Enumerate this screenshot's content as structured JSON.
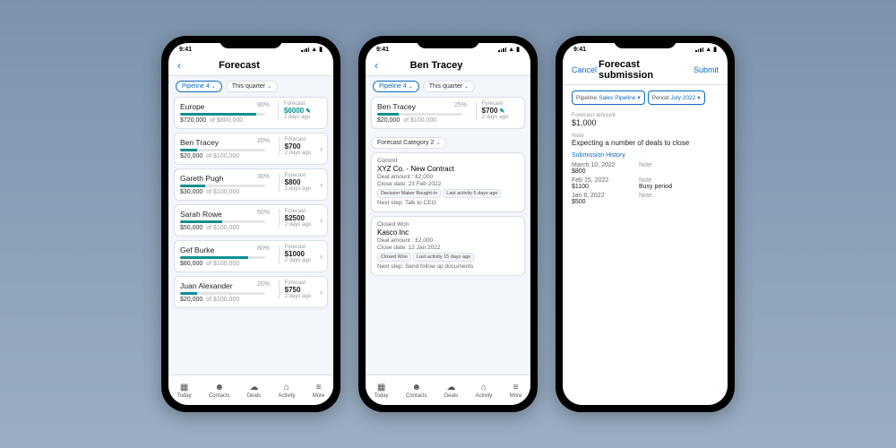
{
  "status": {
    "time": "9:41"
  },
  "tabs": {
    "today": "Today",
    "contacts": "Contacts",
    "deals": "Deals",
    "activity": "Activity",
    "more": "More"
  },
  "p1": {
    "title": "Forecast",
    "filters": {
      "pipeline": "Pipeline 4",
      "period": "This quarter"
    },
    "rows": [
      {
        "name": "Europe",
        "pct": "90%",
        "bar": 90,
        "amount": "$720,000",
        "of": "of $800,000",
        "flabel": "Forecast",
        "fval": "$6000",
        "fago": "2 days ago",
        "teal": true,
        "go": false,
        "pencil": true
      },
      {
        "name": "Ben Tracey",
        "pct": "20%",
        "bar": 20,
        "amount": "$20,000",
        "of": "of $100,000",
        "flabel": "Forecast",
        "fval": "$700",
        "fago": "2 days ago",
        "teal": false,
        "go": true
      },
      {
        "name": "Gareth Pugh",
        "pct": "30%",
        "bar": 30,
        "amount": "$30,000",
        "of": "of $100,000",
        "flabel": "Forecast",
        "fval": "$800",
        "fago": "2 days ago",
        "teal": false,
        "go": true
      },
      {
        "name": "Sarah Rowe",
        "pct": "50%",
        "bar": 50,
        "amount": "$50,000",
        "of": "of $100,000",
        "flabel": "Forecast",
        "fval": "$2500",
        "fago": "2 days ago",
        "teal": false,
        "go": true
      },
      {
        "name": "Gef Burke",
        "pct": "80%",
        "bar": 80,
        "amount": "$80,000",
        "of": "of $100,000",
        "flabel": "Forecast",
        "fval": "$1000",
        "fago": "2 days ago",
        "teal": false,
        "go": true
      },
      {
        "name": "Juan Alexander",
        "pct": "20%",
        "bar": 20,
        "amount": "$20,000",
        "of": "of $100,000",
        "flabel": "Forecast",
        "fval": "$750",
        "fago": "2 days ago",
        "teal": false,
        "go": true
      }
    ]
  },
  "p2": {
    "title": "Ben Tracey",
    "filters": {
      "pipeline": "Pipeline 4",
      "period": "This quarter"
    },
    "summary": {
      "name": "Ben Tracey",
      "pct": "25%",
      "bar": 25,
      "amount": "$20,000",
      "of": "of $100,000",
      "flabel": "Forecast",
      "fval": "$700",
      "fago": "2 days ago",
      "pencil": true
    },
    "category": "Forecast Category 2",
    "deals": [
      {
        "stage": "Commit",
        "title": "XYZ Co. - New Contract",
        "amount": "Deal amount : £2,000",
        "close": "Close date: 23 Feb 2022",
        "tags": [
          "Decision Maker Bought-In",
          "Last activity 5 days ago"
        ],
        "next": "Next step: Talk to CEO"
      },
      {
        "stage": "Closed Won",
        "title": "Kasco Inc",
        "amount": "Deal amount : £2,000",
        "close": "Close date: 12 Jan 2022",
        "tags": [
          "Closed Won",
          "Last activity 15 days ago"
        ],
        "next": "Next step: Send follow up documents"
      }
    ]
  },
  "p3": {
    "cancel": "Cancel",
    "title": "Forecast submission",
    "submit": "Submit",
    "pillPipelineK": "Pipeline",
    "pillPipelineV": "Sales Pipeline",
    "pillPeriodK": "Period",
    "pillPeriodV": "July 2022",
    "amtLbl": "Forecast amount",
    "amtVal": "$1,000",
    "noteLbl": "Note",
    "noteVal": "Expecting a number of deals to close",
    "histLbl": "Submission History",
    "history": [
      {
        "date": "March 10, 2022",
        "amt": "$800",
        "nlbl": "Note",
        "note": ""
      },
      {
        "date": "Feb 15, 2022",
        "amt": "$1100",
        "nlbl": "Note",
        "note": "Busy period"
      },
      {
        "date": "Jan 8, 2022",
        "amt": "$500",
        "nlbl": "Note",
        "note": ""
      }
    ]
  }
}
